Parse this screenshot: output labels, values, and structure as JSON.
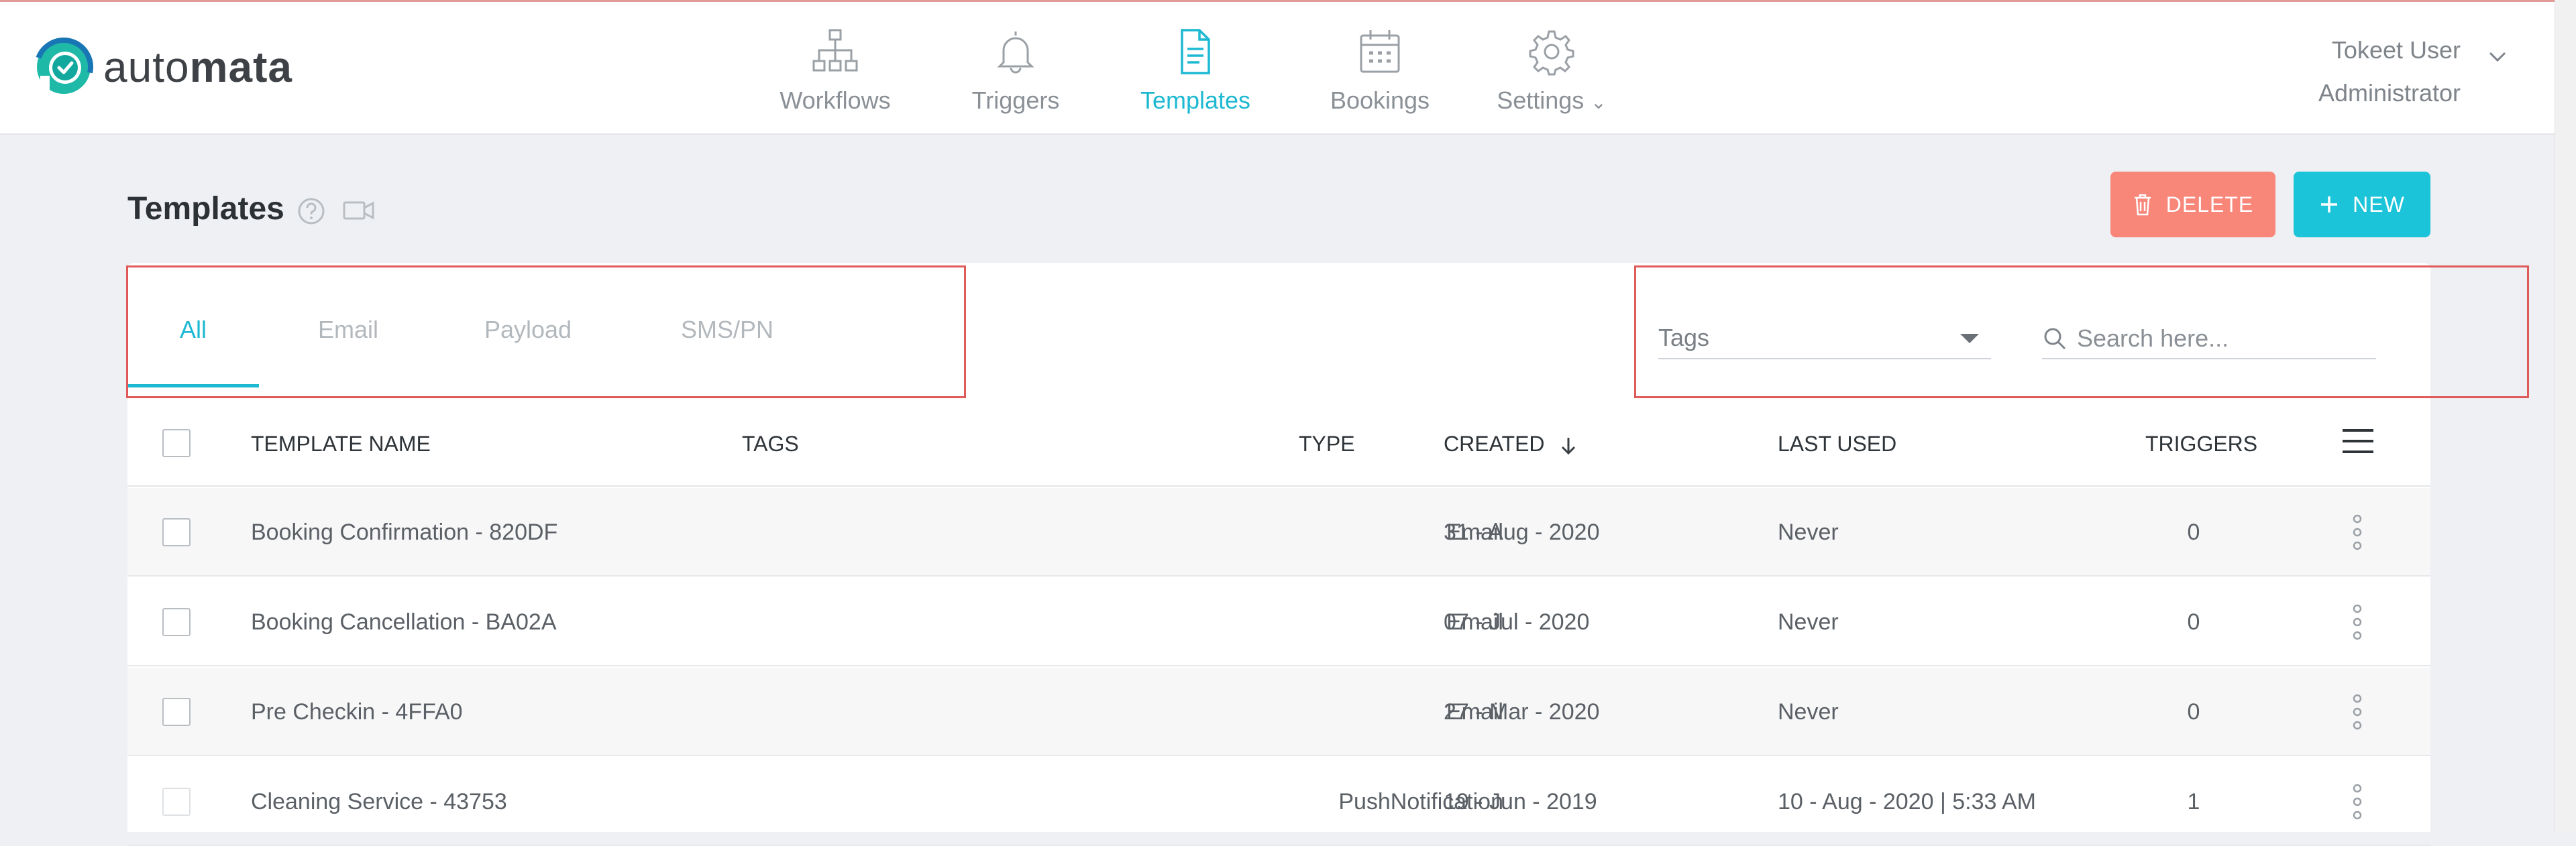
{
  "app": {
    "logo_prefix": "auto",
    "logo_suffix": "mata"
  },
  "nav": {
    "items": [
      {
        "label": "Workflows",
        "icon": "sitemap-icon"
      },
      {
        "label": "Triggers",
        "icon": "bell-icon"
      },
      {
        "label": "Templates",
        "icon": "document-icon",
        "active": true
      },
      {
        "label": "Bookings",
        "icon": "calendar-icon"
      },
      {
        "label": "Settings",
        "icon": "gear-icon"
      }
    ]
  },
  "user": {
    "name": "Tokeet User",
    "role": "Administrator"
  },
  "page": {
    "title": "Templates"
  },
  "actions": {
    "delete_label": "DELETE",
    "new_label": "NEW"
  },
  "tabs": [
    "All",
    "Email",
    "Payload",
    "SMS/PN"
  ],
  "filters": {
    "tags_label": "Tags",
    "search_placeholder": "Search here..."
  },
  "table": {
    "columns": [
      "TEMPLATE NAME",
      "TAGS",
      "TYPE",
      "CREATED",
      "LAST USED",
      "TRIGGERS"
    ],
    "rows": [
      {
        "name": "Booking Confirmation - 820DF",
        "tags": "",
        "type": "Email",
        "created": "31 - Aug - 2020",
        "last_used": "Never",
        "triggers": "0"
      },
      {
        "name": "Booking Cancellation - BA02A",
        "tags": "",
        "type": "Email",
        "created": "07 - Jul - 2020",
        "last_used": "Never",
        "triggers": "0"
      },
      {
        "name": "Pre Checkin - 4FFA0",
        "tags": "",
        "type": "Email",
        "created": "27 - Mar - 2020",
        "last_used": "Never",
        "triggers": "0"
      },
      {
        "name": "Cleaning Service - 43753",
        "tags": "",
        "type": "PushNotification",
        "created": "19 - Jun - 2019",
        "last_used": "10 - Aug - 2020 | 5:33 AM",
        "triggers": "1"
      }
    ]
  },
  "colors": {
    "accent": "#1db9d2",
    "delete": "#f8877a",
    "new": "#1cc4d9",
    "highlight": "#e05a5a"
  }
}
